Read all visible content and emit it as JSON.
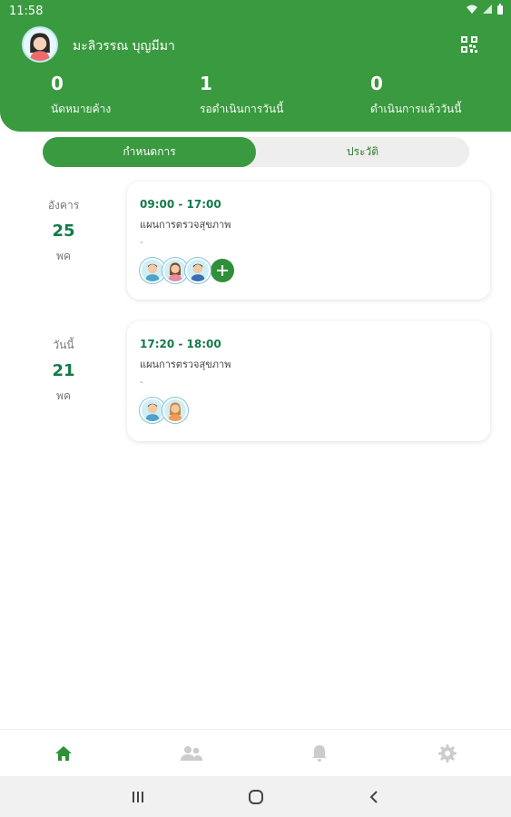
{
  "status_bar": {
    "time": "11:58"
  },
  "user": {
    "name": "มะลิวรรณ บุญมีมา"
  },
  "stats": [
    {
      "value": "0",
      "label": "นัดหมายค้าง"
    },
    {
      "value": "1",
      "label": "รอดำเนินการวันนี้"
    },
    {
      "value": "0",
      "label": "ดำเนินการแล้ววันนี้"
    }
  ],
  "tabs": [
    {
      "label": "กำหนดการ",
      "active": true
    },
    {
      "label": "ประวัติ",
      "active": false
    }
  ],
  "schedule": [
    {
      "date": {
        "dow": "อังคาร",
        "day": "25",
        "month": "พค"
      },
      "time": "09:00 - 17:00",
      "title": "แผนการตรวจสุขภาพ",
      "subtitle": "-",
      "people": [
        "person-male",
        "person-female",
        "person-male"
      ]
    },
    {
      "date": {
        "dow": "วันนี้",
        "day": "21",
        "month": "พค"
      },
      "time": "17:20 - 18:00",
      "title": "แผนการตรวจสุขภาพ",
      "subtitle": "-",
      "people": [
        "person-male",
        "person-female"
      ]
    }
  ],
  "bottom_nav": [
    "home-icon",
    "people-icon",
    "bell-icon",
    "gear-icon"
  ],
  "colors": {
    "brand_green": "#3a9a3f",
    "accent_teal": "#137a4a",
    "inactive_icon": "#cccccc"
  }
}
